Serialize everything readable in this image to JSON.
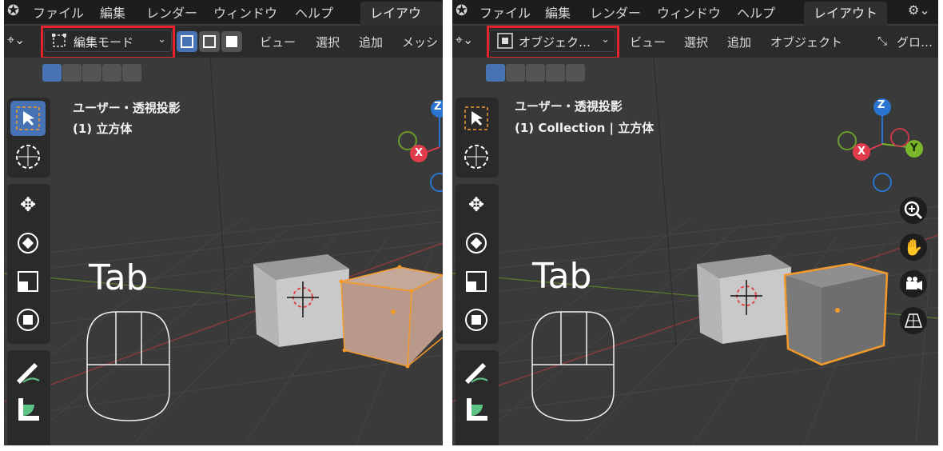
{
  "menu": {
    "items": [
      "ファイル",
      "編集",
      "レンダー",
      "ウィンドウ",
      "ヘルプ"
    ],
    "workspace_tab": "レイアウト"
  },
  "left": {
    "mode_label": "編集モード",
    "header_items": [
      "ビュー",
      "選択",
      "追加",
      "メッシ"
    ],
    "overlay_title": "ユーザー・透視投影",
    "overlay_sub": "(1) 立方体",
    "key_label": "Tab"
  },
  "right": {
    "mode_label": "オブジェク…",
    "header_items": [
      "ビュー",
      "選択",
      "追加",
      "オブジェクト"
    ],
    "transform_label": "グロ…",
    "overlay_title": "ユーザー・透視投影",
    "overlay_sub": "(1) Collection | 立方体",
    "key_label": "Tab"
  },
  "gizmo": {
    "z": "Z",
    "x": "X",
    "y": "Y"
  },
  "colors": {
    "highlight_box": "#e8222b",
    "selection_orange": "#f39a2b",
    "active_blue": "#4772b3"
  }
}
